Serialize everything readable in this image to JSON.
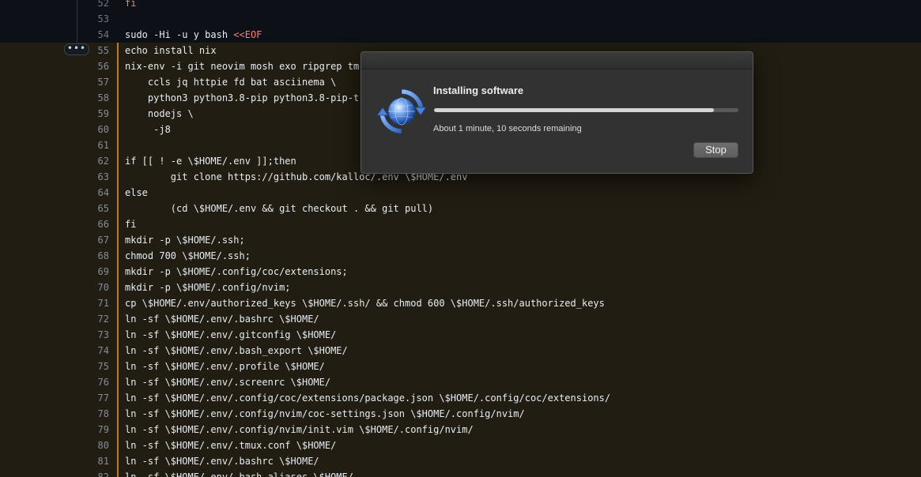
{
  "editor": {
    "expand_label": "•••",
    "lines": [
      {
        "num": "52",
        "tokens": [
          {
            "text": "fi",
            "cls": "kw-red"
          }
        ]
      },
      {
        "num": "53",
        "tokens": []
      },
      {
        "num": "54",
        "tokens": [
          {
            "text": "sudo -Hi -u y bash "
          },
          {
            "text": "<<EOF",
            "cls": "kw-str"
          }
        ]
      },
      {
        "num": "55",
        "hl": true,
        "tokens": [
          {
            "text": "echo install nix"
          }
        ]
      },
      {
        "num": "56",
        "hl": true,
        "tokens": [
          {
            "text": "nix-env -i git neovim mosh exo ripgrep tm"
          }
        ]
      },
      {
        "num": "57",
        "hl": true,
        "tokens": [
          {
            "text": "    ccls jq httpie fd bat asciinema \\"
          }
        ]
      },
      {
        "num": "58",
        "hl": true,
        "tokens": [
          {
            "text": "    python3 python3.8-pip python3.8-pip-t"
          }
        ]
      },
      {
        "num": "59",
        "hl": true,
        "tokens": [
          {
            "text": "    nodejs \\"
          }
        ]
      },
      {
        "num": "60",
        "hl": true,
        "tokens": [
          {
            "text": "     -j8"
          }
        ]
      },
      {
        "num": "61",
        "hl": true,
        "tokens": []
      },
      {
        "num": "62",
        "hl": true,
        "tokens": [
          {
            "text": "if [[ ! -e \\$HOME/.env ]];then"
          }
        ]
      },
      {
        "num": "63",
        "hl": true,
        "tokens": [
          {
            "text": "        git clone https://github.com/kalloc/.env \\$HOME/.env"
          }
        ]
      },
      {
        "num": "64",
        "hl": true,
        "tokens": [
          {
            "text": "else"
          }
        ]
      },
      {
        "num": "65",
        "hl": true,
        "tokens": [
          {
            "text": "        (cd \\$HOME/.env && git checkout . && git pull)"
          }
        ]
      },
      {
        "num": "66",
        "hl": true,
        "tokens": [
          {
            "text": "fi"
          }
        ]
      },
      {
        "num": "67",
        "hl": true,
        "tokens": [
          {
            "text": "mkdir -p \\$HOME/.ssh;"
          }
        ]
      },
      {
        "num": "68",
        "hl": true,
        "tokens": [
          {
            "text": "chmod 700 \\$HOME/.ssh;"
          }
        ]
      },
      {
        "num": "69",
        "hl": true,
        "tokens": [
          {
            "text": "mkdir -p \\$HOME/.config/coc/extensions;"
          }
        ]
      },
      {
        "num": "70",
        "hl": true,
        "tokens": [
          {
            "text": "mkdir -p \\$HOME/.config/nvim;"
          }
        ]
      },
      {
        "num": "71",
        "hl": true,
        "tokens": [
          {
            "text": "cp \\$HOME/.env/authorized_keys \\$HOME/.ssh/ && chmod 600 \\$HOME/.ssh/authorized_keys"
          }
        ]
      },
      {
        "num": "72",
        "hl": true,
        "tokens": [
          {
            "text": "ln -sf \\$HOME/.env/.bashrc \\$HOME/"
          }
        ]
      },
      {
        "num": "73",
        "hl": true,
        "tokens": [
          {
            "text": "ln -sf \\$HOME/.env/.gitconfig \\$HOME/"
          }
        ]
      },
      {
        "num": "74",
        "hl": true,
        "tokens": [
          {
            "text": "ln -sf \\$HOME/.env/.bash_export \\$HOME/"
          }
        ]
      },
      {
        "num": "75",
        "hl": true,
        "tokens": [
          {
            "text": "ln -sf \\$HOME/.env/.profile \\$HOME/"
          }
        ]
      },
      {
        "num": "76",
        "hl": true,
        "tokens": [
          {
            "text": "ln -sf \\$HOME/.env/.screenrc \\$HOME/"
          }
        ]
      },
      {
        "num": "77",
        "hl": true,
        "tokens": [
          {
            "text": "ln -sf \\$HOME/.env/.config/coc/extensions/package.json \\$HOME/.config/coc/extensions/"
          }
        ]
      },
      {
        "num": "78",
        "hl": true,
        "tokens": [
          {
            "text": "ln -sf \\$HOME/.env/.config/nvim/coc-settings.json \\$HOME/.config/nvim/"
          }
        ]
      },
      {
        "num": "79",
        "hl": true,
        "tokens": [
          {
            "text": "ln -sf \\$HOME/.env/.config/nvim/init.vim \\$HOME/.config/nvim/"
          }
        ]
      },
      {
        "num": "80",
        "hl": true,
        "tokens": [
          {
            "text": "ln -sf \\$HOME/.env/.tmux.conf \\$HOME/"
          }
        ]
      },
      {
        "num": "81",
        "hl": true,
        "tokens": [
          {
            "text": "ln -sf \\$HOME/.env/.bashrc \\$HOME/"
          }
        ]
      },
      {
        "num": "82",
        "hl": true,
        "tokens": [
          {
            "text": "ln -sf \\$HOME/.env/.bash_aliases \\$HOME/"
          }
        ]
      }
    ]
  },
  "installer_dialog": {
    "title": "Installing software",
    "status": "About 1 minute, 10 seconds remaining",
    "progress_fraction": 0.92,
    "stop_label": "Stop",
    "icon": "software-update-globe-icon"
  },
  "colors": {
    "background": "#0d1117",
    "highlight_background": "#221d12",
    "highlight_bar": "#bb8009",
    "keyword_red": "#ff7b72",
    "dialog_background": "#323232"
  }
}
